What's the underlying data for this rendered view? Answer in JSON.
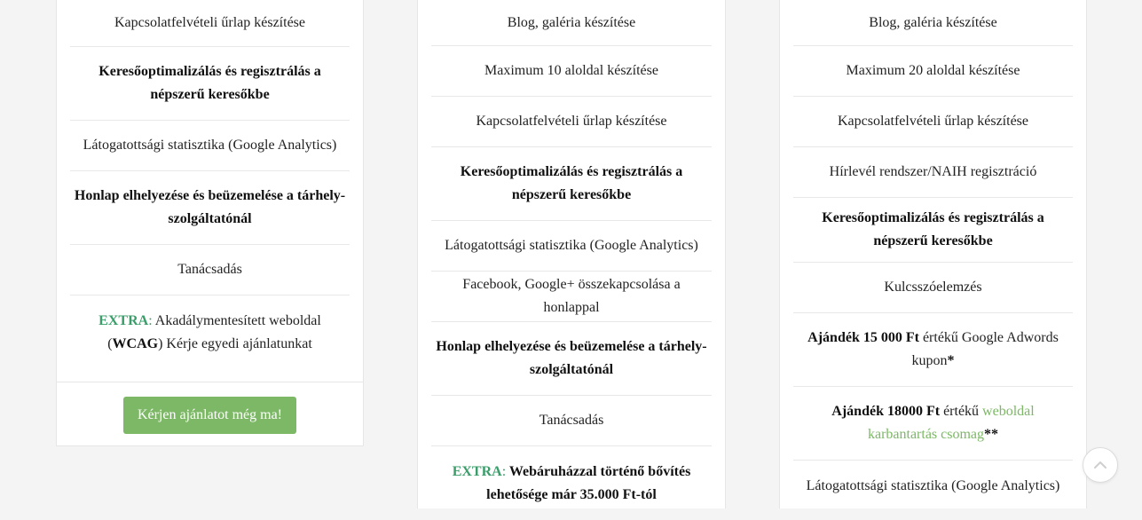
{
  "col1": {
    "f1": "Kapcsolatfelvételi űrlap készítése",
    "f2": "Keresőoptimalizálás és regisztrálás a népszerű keresőkbe",
    "f3": "Látogatottsági statisztika (Google Analytics)",
    "f4": "Honlap elhelyezése és beüzemelése a tárhely-szolgáltatónál",
    "f5": "Tanácsadás",
    "f6_extra": "EXTRA",
    "f6_colon": ":",
    "f6_a": " Akadálymentesített weboldal (",
    "f6_wcag": "WCAG",
    "f6_b": ") Kérje egyedi ajánlatunkat",
    "cta": "Kérjen ajánlatot még ma!"
  },
  "col2": {
    "f1": "Blog, galéria készítése",
    "f2": "Maximum 10 aloldal készítése",
    "f3": "Kapcsolatfelvételi űrlap készítése",
    "f4": "Keresőoptimalizálás és regisztrálás a népszerű keresőkbe",
    "f5": "Látogatottsági statisztika (Google Analytics)",
    "f6": "Facebook, Google+ összekapcsolása a honlappal",
    "f7": "Honlap elhelyezése és beüzemelése a tárhely-szolgáltatónál",
    "f8": "Tanácsadás",
    "f9_extra": "EXTRA",
    "f9_colon": ":",
    "f9_text": " Webáruházzal történő bővítés lehetősége már 35.000 Ft-tól"
  },
  "col3": {
    "f1": "Blog, galéria készítése",
    "f2": "Maximum 20 aloldal készítése",
    "f3": "Kapcsolatfelvételi űrlap készítése",
    "f4": "Hírlevél rendszer/NAIH regisztráció",
    "f5": "Keresőoptimalizálás és regisztrálás a népszerű keresőkbe",
    "f6": "Kulcsszóelemzés",
    "f7_bold": "Ajándék 15 000 Ft",
    "f7_text": " értékű Google Adwords kupon",
    "f7_star": "*",
    "f8_bold": "Ajándék 18000 Ft",
    "f8_text": " értékű ",
    "f8_link": "weboldal karbantartás csomag",
    "f8_star": "**",
    "f9": "Látogatottsági statisztika (Google Analytics)"
  },
  "colors": {
    "accent": "#7cb865",
    "extra": "#3a9d6a"
  },
  "icons": {
    "scroll_top": "chevron-up-icon"
  }
}
